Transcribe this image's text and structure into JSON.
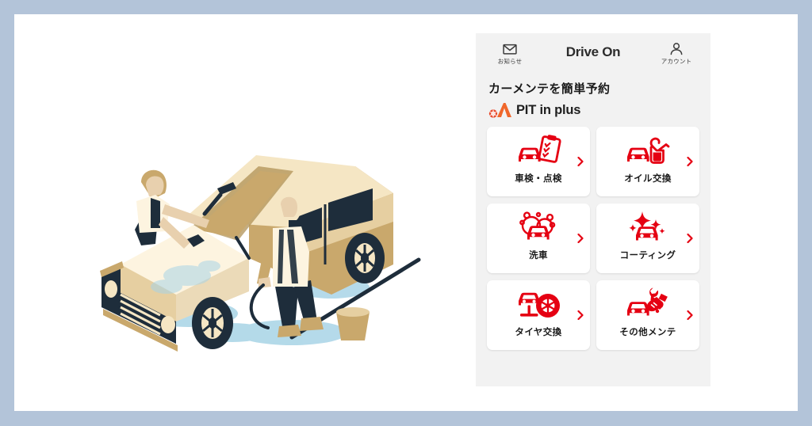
{
  "theme": {
    "outer_frame_color": "#b3c4d9",
    "page_background": "#ffffff",
    "panel_background": "#f2f2f2",
    "card_background": "#ffffff",
    "accent_red": "#e50012",
    "brand_orange": "#f0672b",
    "text_dark": "#1a1a1a"
  },
  "illustration": {
    "name": "car-wash-isometric-illustration",
    "description": "Isometric illustration of two people washing a beige van with a hose and bucket",
    "colors": {
      "body_light": "#f5e6c4",
      "body_mid": "#e6cfa1",
      "body_dark": "#c9a86c",
      "shadow_dark": "#1e2d3b",
      "water_blue": "#a8d4e6",
      "skin": "#e8d0ae"
    }
  },
  "app": {
    "header": {
      "left": {
        "icon": "mail-envelope-icon",
        "label": "お知らせ"
      },
      "title": "Drive On",
      "right": {
        "icon": "account-person-icon",
        "label": "アカウント"
      }
    },
    "headline": "カーメンテを簡単予約",
    "brand": {
      "mark_icon": "pit-in-plus-logo-icon",
      "name": "PIT in plus"
    },
    "services": [
      {
        "id": "shaken-tenken",
        "label": "車検・点検",
        "icon": "car-clipboard-inspection-icon",
        "chevron": "chevron-right-icon"
      },
      {
        "id": "oil-change",
        "label": "オイル交換",
        "icon": "car-oil-can-icon",
        "chevron": "chevron-right-icon"
      },
      {
        "id": "car-wash",
        "label": "洗車",
        "icon": "car-bubbles-wash-icon",
        "chevron": "chevron-right-icon"
      },
      {
        "id": "coating",
        "label": "コーティング",
        "icon": "car-sparkle-coating-icon",
        "chevron": "chevron-right-icon"
      },
      {
        "id": "tire-change",
        "label": "タイヤ交換",
        "icon": "car-lift-tire-icon",
        "chevron": "chevron-right-icon"
      },
      {
        "id": "other-maint",
        "label": "その他メンテ",
        "icon": "car-wrench-handshake-icon",
        "chevron": "chevron-right-icon"
      }
    ]
  }
}
